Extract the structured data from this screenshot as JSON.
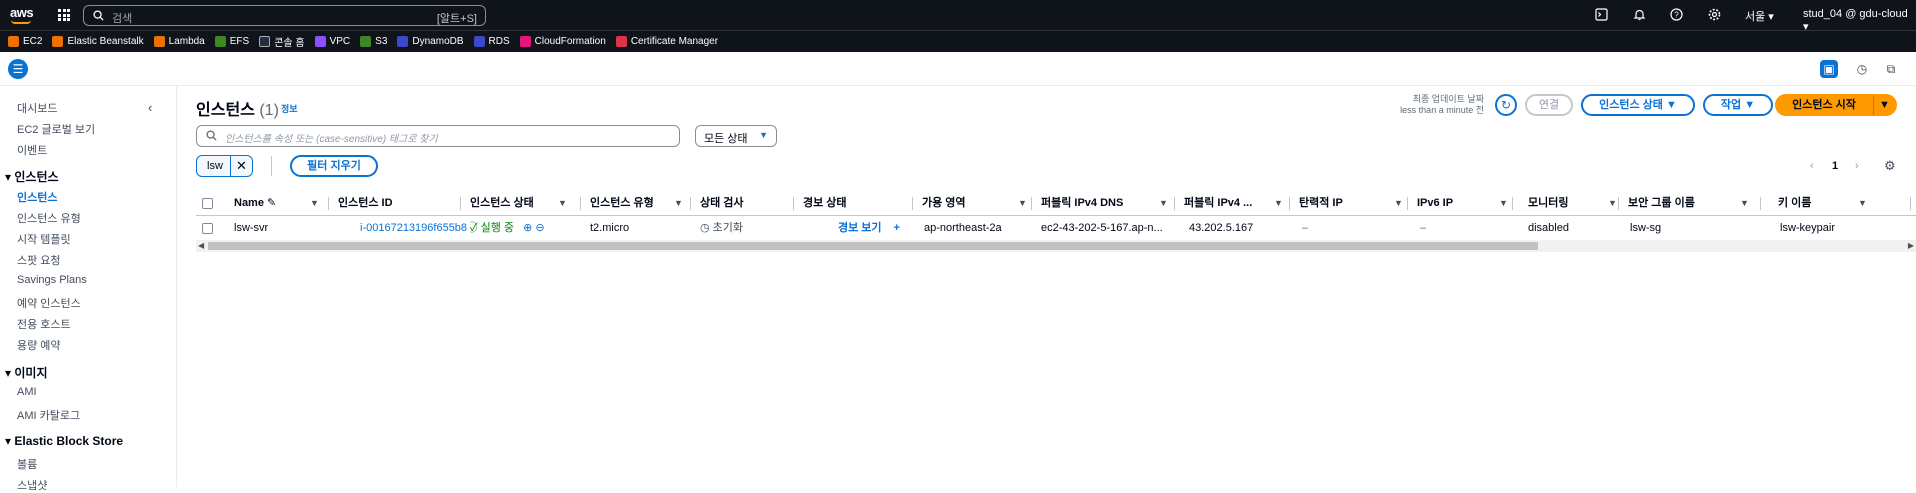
{
  "topbar": {
    "logo": "aws",
    "search_placeholder": "검색",
    "search_shortcut": "[알트+S]",
    "region": "서울 ▾",
    "account": "stud_04 @ gdu-cloud ▾"
  },
  "favorites": [
    {
      "label": "EC2",
      "color": "#ed7100"
    },
    {
      "label": "Elastic Beanstalk",
      "color": "#ed7100"
    },
    {
      "label": "Lambda",
      "color": "#ed7100"
    },
    {
      "label": "EFS",
      "color": "#3f8624"
    },
    {
      "label": "콘솔 홈",
      "color": "#232f3e"
    },
    {
      "label": "VPC",
      "color": "#8c4fff"
    },
    {
      "label": "S3",
      "color": "#3f8624"
    },
    {
      "label": "DynamoDB",
      "color": "#3b48cc"
    },
    {
      "label": "RDS",
      "color": "#3b48cc"
    },
    {
      "label": "CloudFormation",
      "color": "#e7157b"
    },
    {
      "label": "Certificate Manager",
      "color": "#dd344c"
    }
  ],
  "sidebar": {
    "links_top": [
      "대시보드",
      "EC2 글로벌 보기",
      "이벤트"
    ],
    "section_instances": "인스턴스",
    "instances_items": [
      "인스턴스",
      "인스턴스 유형",
      "시작 템플릿",
      "스팟 요청",
      "Savings Plans",
      "예약 인스턴스",
      "전용 호스트",
      "용량 예약"
    ],
    "section_images": "이미지",
    "images_items": [
      "AMI",
      "AMI 카탈로그"
    ],
    "section_ebs": "Elastic Block Store",
    "ebs_items": [
      "볼륨",
      "스냅샷"
    ]
  },
  "header": {
    "title": "인스턴스",
    "count": "(1)",
    "info": "정보",
    "updated_line1": "최종 업데이트 날짜",
    "updated_line2": "less than a minute 전",
    "connect": "연결",
    "instance_state": "인스턴스 상태 ▼",
    "actions": "작업 ▼",
    "launch": "인스턴스 시작",
    "launch_caret": "▼"
  },
  "filter": {
    "placeholder": "인스턴스를 속성 또는 (case-sensitive) 태그로 찾기",
    "state_select": "모든 상태",
    "token": "lsw",
    "clear": "필터 지우기",
    "page": "1"
  },
  "table": {
    "columns": [
      "Name",
      "인스턴스 ID",
      "인스턴스 상태",
      "인스턴스 유형",
      "상태 검사",
      "경보 상태",
      "가용 영역",
      "퍼블릭 IPv4 DNS",
      "퍼블릭 IPv4 ...",
      "탄력적 IP",
      "IPv6 IP",
      "모니터링",
      "보안 그룹 이름",
      "키 이름"
    ],
    "rows": [
      {
        "name": "lsw-svr",
        "instance_id": "i-00167213196f655b8",
        "state": "실행 중",
        "type": "t2.micro",
        "status_check": "초기화",
        "alarm": "경보 보기",
        "az": "ap-northeast-2a",
        "dns": "ec2-43-202-5-167.ap-n...",
        "ipv4": "43.202.5.167",
        "eip": "–",
        "ipv6": "–",
        "monitoring": "disabled",
        "sg": "lsw-sg",
        "key": "lsw-keypair"
      }
    ]
  }
}
